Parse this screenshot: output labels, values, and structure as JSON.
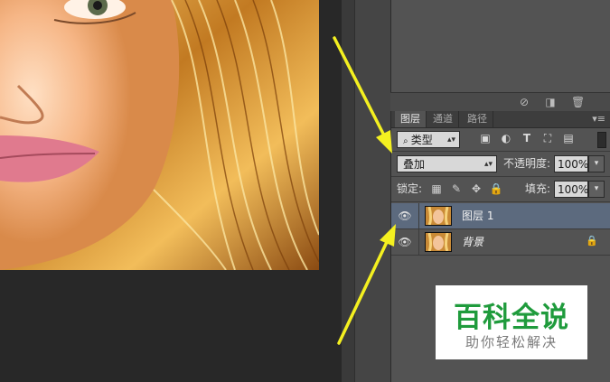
{
  "panel_tabs": [
    {
      "label": "图层",
      "active": true
    },
    {
      "label": "通道",
      "active": false
    },
    {
      "label": "路径",
      "active": false
    }
  ],
  "filter": {
    "kind_label": "类型",
    "icons": [
      "image-filter-icon",
      "adjustment-filter-icon",
      "type-filter-icon",
      "shape-filter-icon",
      "smart-object-filter-icon"
    ]
  },
  "blend": {
    "mode": "叠加",
    "opacity_label": "不透明度:",
    "opacity_value": "100%"
  },
  "lock": {
    "label": "锁定:",
    "fill_label": "填充:",
    "fill_value": "100%"
  },
  "layers": [
    {
      "name": "图层 1",
      "selected": true,
      "locked": false,
      "italic": false
    },
    {
      "name": "背景",
      "selected": false,
      "locked": true,
      "italic": true
    }
  ],
  "watermark": {
    "main": "百科全说",
    "sub": "助你轻松解决"
  },
  "colors": {
    "arrow": "#f4f020",
    "selection": "#5c6a7e",
    "watermark_green": "#1f9b3c"
  }
}
